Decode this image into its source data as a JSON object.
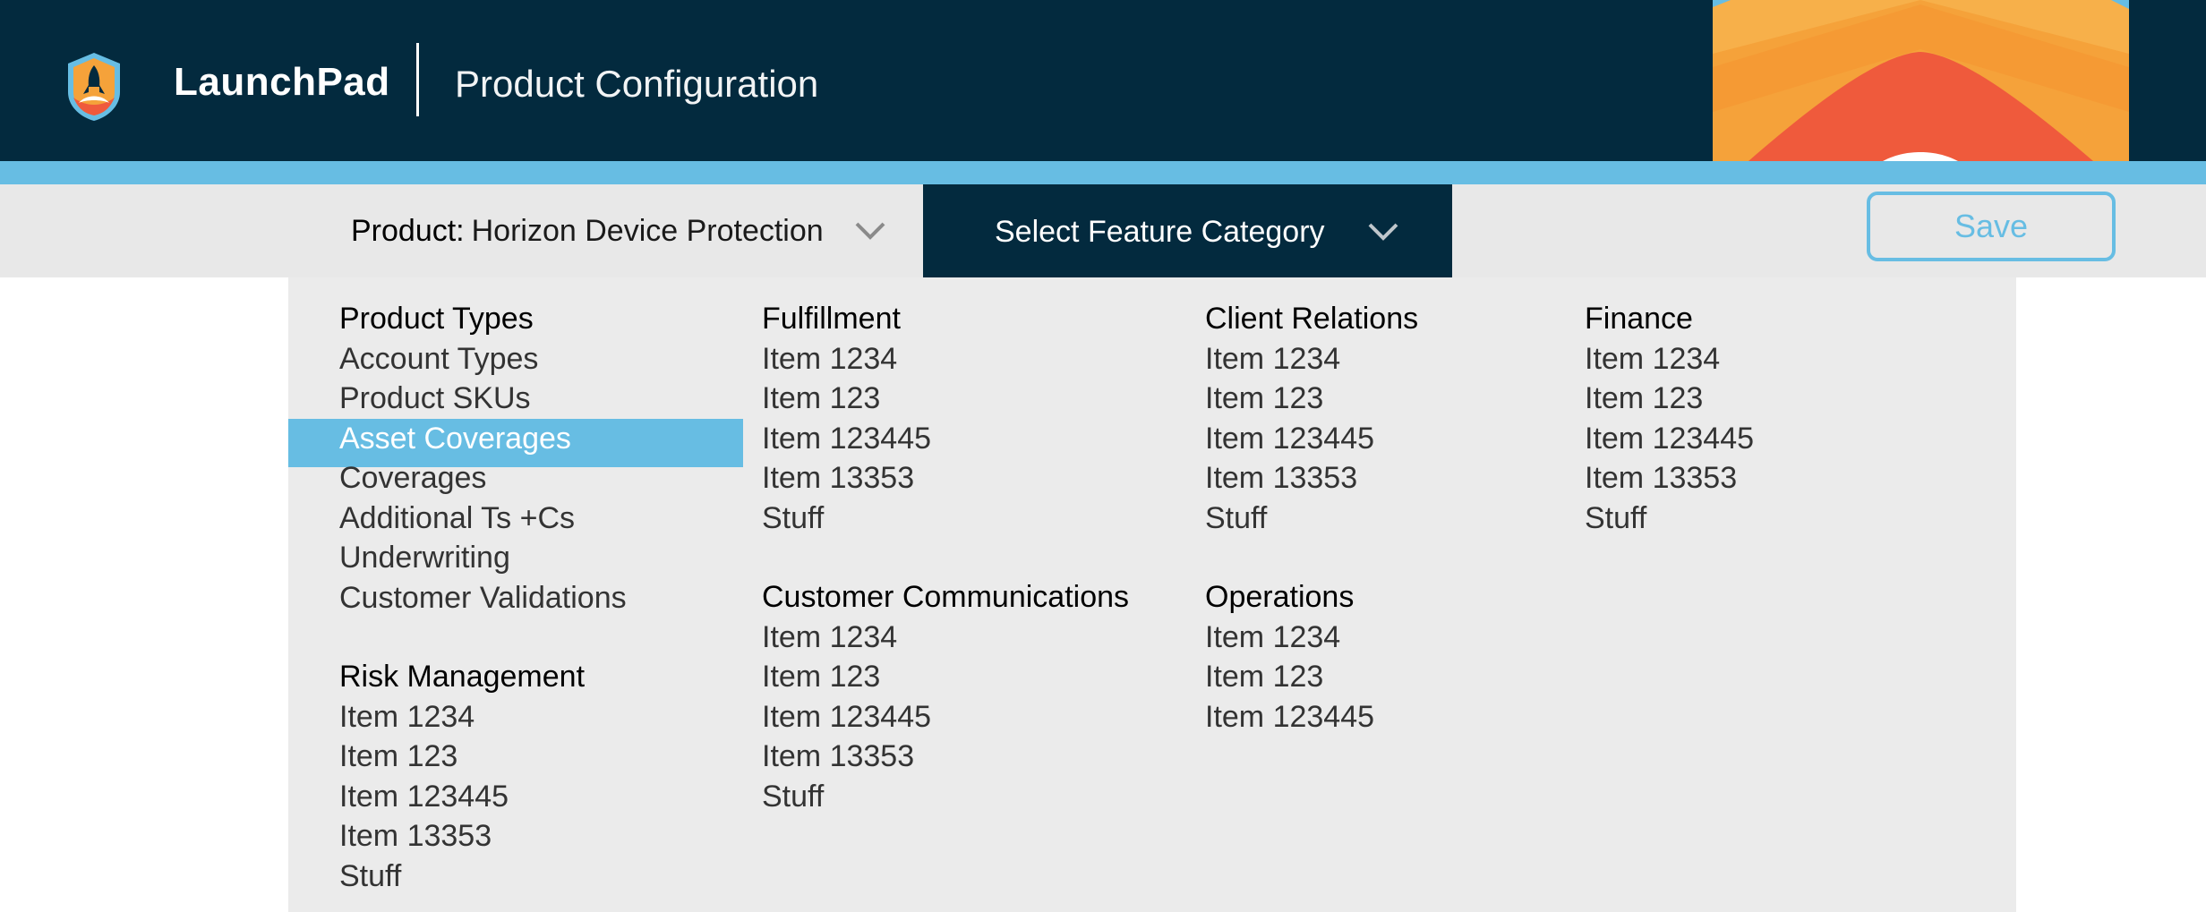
{
  "header": {
    "brand": "LaunchPad",
    "page_title": "Product Configuration"
  },
  "toolbar": {
    "product_label": "Product:",
    "product_value": "Horizon Device Protection",
    "category_label": "Select Feature Category",
    "save_label": "Save"
  },
  "colors": {
    "header_bg": "#032a3e",
    "accent_blue": "#67bde3",
    "toolbar_bg": "#e8e8e8",
    "menu_bg": "#ebebeb"
  },
  "icons": {
    "logo": "rocket-shield-icon",
    "dropdown": "chevron-down-icon"
  },
  "menu": {
    "columns": [
      {
        "groups": [
          {
            "heading": "Product Types",
            "items": [
              "Account Types",
              "Product SKUs",
              "Asset Coverages",
              "Coverages",
              "Additional Ts +Cs",
              "Underwriting",
              "Customer Validations"
            ]
          },
          {
            "heading": "Risk Management",
            "items": [
              "Item 1234",
              "Item 123",
              "Item 123445",
              "Item 13353",
              "Stuff"
            ]
          }
        ]
      },
      {
        "groups": [
          {
            "heading": "Fulfillment",
            "items": [
              "Item 1234",
              "Item 123",
              "Item 123445",
              "Item 13353",
              "Stuff"
            ]
          },
          {
            "heading": "Customer Communications",
            "items": [
              "Item 1234",
              "Item 123",
              "Item 123445",
              "Item 13353",
              "Stuff"
            ]
          }
        ]
      },
      {
        "groups": [
          {
            "heading": "Client Relations",
            "items": [
              "Item 1234",
              "Item 123",
              "Item 123445",
              "Item 13353",
              "Stuff"
            ]
          },
          {
            "heading": "Operations",
            "items": [
              "Item 1234",
              "Item 123",
              "Item 123445"
            ]
          }
        ]
      },
      {
        "groups": [
          {
            "heading": "Finance",
            "items": [
              "Item 1234",
              "Item 123",
              "Item 123445",
              "Item 13353",
              "Stuff"
            ]
          }
        ]
      }
    ],
    "selected_item": "Asset Coverages"
  }
}
